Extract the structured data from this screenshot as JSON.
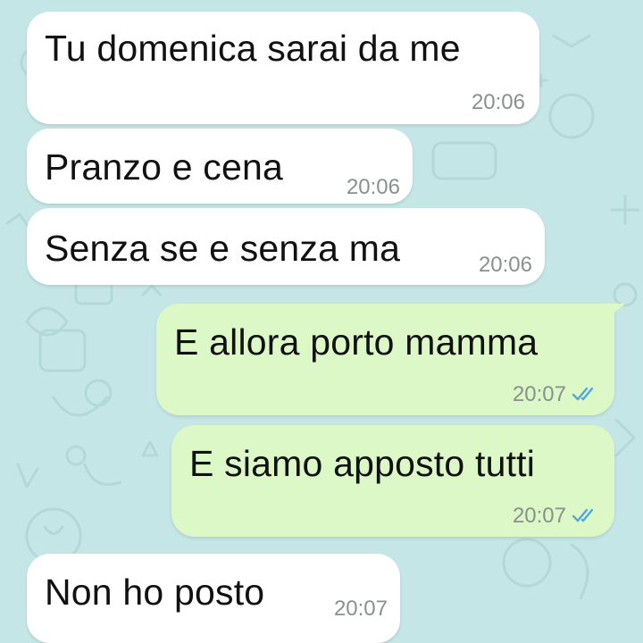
{
  "colors": {
    "incoming_bg": "#ffffff",
    "outgoing_bg": "#dcf8c6",
    "wallpaper": "#c5e6e6",
    "read_ticks": "#4fa7e5",
    "timestamp": "#8a8f8f"
  },
  "messages": [
    {
      "direction": "incoming",
      "text": "Tu domenica sarai da me",
      "time": "20:06"
    },
    {
      "direction": "incoming",
      "text": "Pranzo e cena",
      "time": "20:06"
    },
    {
      "direction": "incoming",
      "text": "Senza se e senza ma",
      "time": "20:06"
    },
    {
      "direction": "outgoing",
      "text": "E allora porto mamma",
      "time": "20:07",
      "status_icon": "double-check-read-icon"
    },
    {
      "direction": "outgoing",
      "text": "E siamo apposto tutti",
      "time": "20:07",
      "status_icon": "double-check-read-icon"
    },
    {
      "direction": "incoming",
      "text": "Non ho posto",
      "time": "20:07"
    }
  ]
}
